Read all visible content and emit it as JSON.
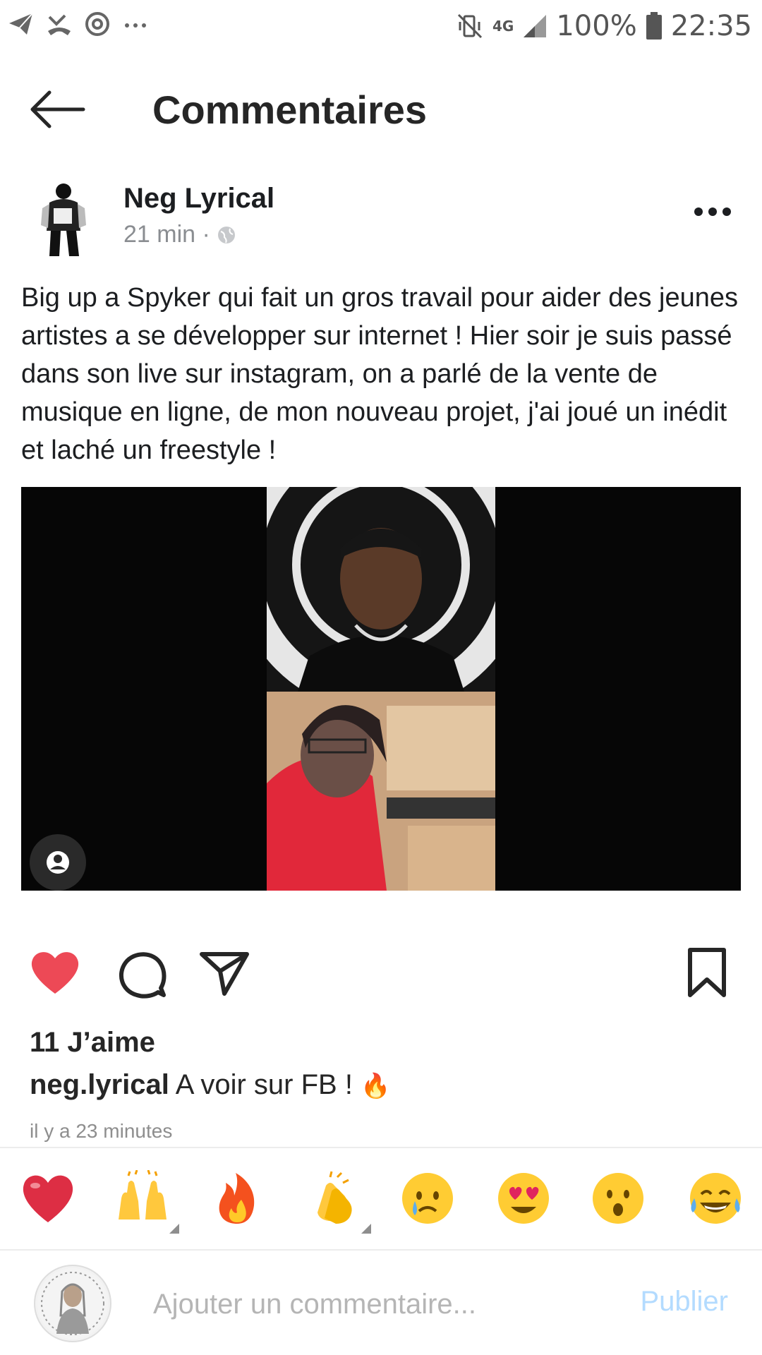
{
  "status_bar": {
    "battery": "100%",
    "time": "22:35",
    "network": "4G",
    "icons": [
      "telegram-icon",
      "missed-call-icon",
      "data-saver-icon",
      "more-notifications-icon",
      "mute-vibrate-icon",
      "signal-icon",
      "battery-icon"
    ]
  },
  "header": {
    "title": "Commentaires"
  },
  "post": {
    "author": "Neg Lyrical",
    "time": "21 min ·",
    "text": "Big up a Spyker qui fait un gros travail pour aider des jeunes artistes a se développer sur internet ! Hier soir je suis passé dans son live sur instagram, on a parlé de la vente de musique en ligne, de mon nouveau projet, j'ai joué un inédit et laché un freestyle !"
  },
  "engagement": {
    "likes": "11 J’aime",
    "caption_user": "neg.lyrical",
    "caption_text": "A voir sur FB ! ",
    "time_ago": "il y a 23 minutes"
  },
  "quick_reactions": [
    "❤️",
    "🙌",
    "🔥",
    "👏",
    "😢",
    "😍",
    "😮",
    "😂"
  ],
  "comment": {
    "placeholder": "Ajouter un commentaire...",
    "publish_label": "Publier"
  },
  "colors": {
    "like_red": "#ed4956",
    "publish_disabled": "#b3dbff",
    "muted_text": "#8e8e8e"
  }
}
